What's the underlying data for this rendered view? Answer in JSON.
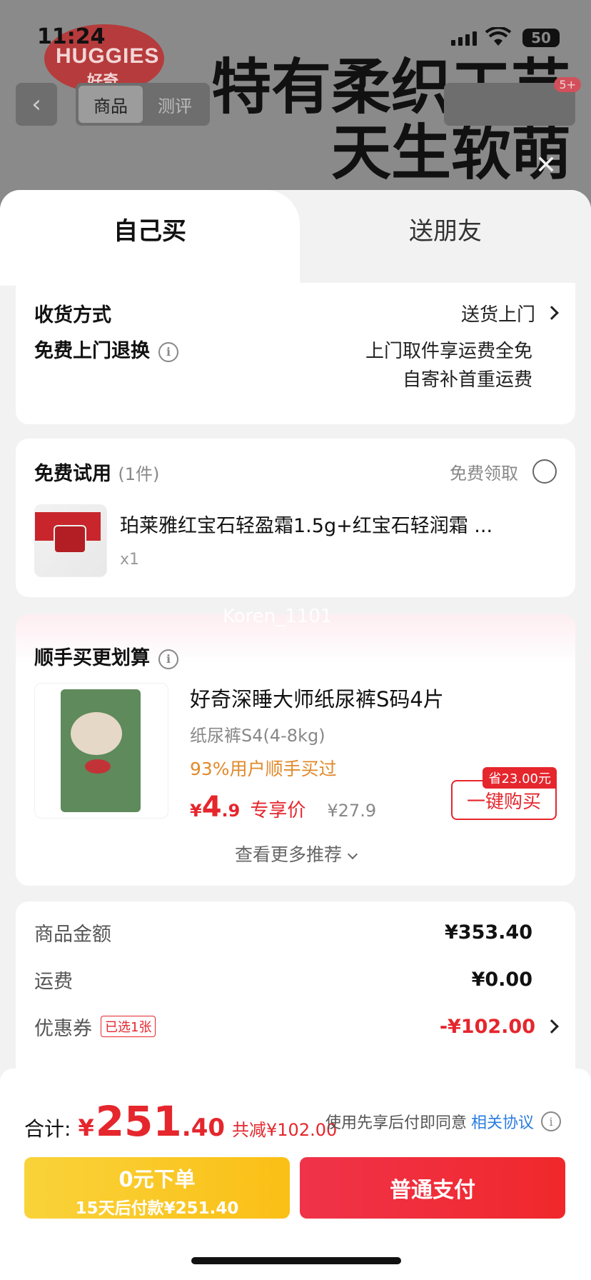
{
  "status": {
    "time": "11:24",
    "battery": "50"
  },
  "background": {
    "logo": "HUGGIES",
    "logo_sub": "好奇",
    "slogan_line1": "特有柔织工艺",
    "slogan_line2": "天生软萌",
    "tabs": [
      "商品",
      "测评"
    ],
    "badge": "5+"
  },
  "sheet": {
    "tab_self": "自己买",
    "tab_friend": "送朋友",
    "delivery": {
      "label": "收货方式",
      "value": "送货上门",
      "return_label": "免费上门退换",
      "return_line1": "上门取件享运费全免",
      "return_line2": "自寄补首重运费"
    },
    "trial": {
      "label": "免费试用",
      "count": "(1件)",
      "claim": "免费领取",
      "item_name": "珀莱雅红宝石轻盈霜1.5g+红宝石轻润霜 ...",
      "item_qty": "x1"
    },
    "addon": {
      "watermark": "Koren_1101",
      "label": "顺手买更划算",
      "item_name": "好奇深睡大师纸尿裤S码4片",
      "item_spec": "纸尿裤S4(4-8kg)",
      "social": "93%用户顺手买过",
      "price_sym": "¥",
      "price_int": "4",
      "price_dec": ".9",
      "price_tag": "专享价",
      "price_orig": "¥27.9",
      "save_badge": "省23.00元",
      "buy_label": "一键购买",
      "more": "查看更多推荐"
    },
    "summary": {
      "goods_label": "商品金额",
      "goods_value": "¥353.40",
      "ship_label": "运费",
      "ship_value": "¥0.00",
      "coupon_label": "优惠券",
      "coupon_tag": "已选1张",
      "coupon_value": "-¥102.00"
    }
  },
  "bottom": {
    "total_label": "合计:",
    "total_sym": "¥",
    "total_int": "251",
    "total_dec": ".40",
    "total_save": "共减¥102.00",
    "agree_text": "使用先享后付即同意",
    "agree_link": "相关协议",
    "credit_line1": "0元下单",
    "credit_line2": "15天后付款¥251.40",
    "pay_label": "普通支付"
  },
  "colors": {
    "accent_red": "#e5262d",
    "credit_yellow": "#fbbf16",
    "link_blue": "#2a7de0"
  }
}
